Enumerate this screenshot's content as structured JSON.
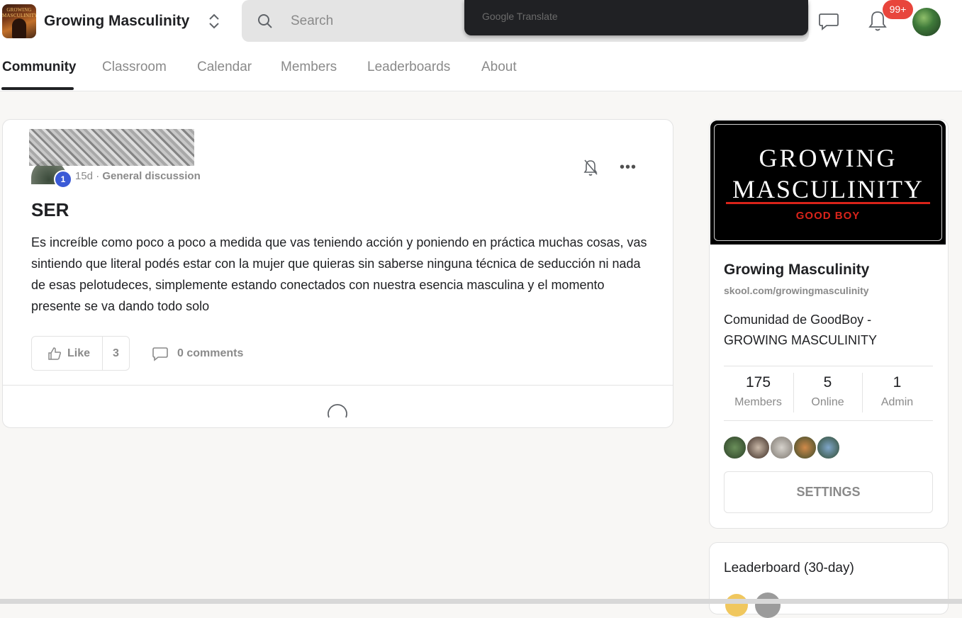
{
  "header": {
    "brand": "Growing Masculinity",
    "logo_text": "GROWING MASCULINITY",
    "search_placeholder": "Search",
    "translate_bar": "Google Translate",
    "notifications_badge": "99+"
  },
  "nav": {
    "tabs": [
      {
        "label": "Community",
        "active": true
      },
      {
        "label": "Classroom",
        "active": false
      },
      {
        "label": "Calendar",
        "active": false
      },
      {
        "label": "Members",
        "active": false
      },
      {
        "label": "Leaderboards",
        "active": false
      },
      {
        "label": "About",
        "active": false
      }
    ]
  },
  "post": {
    "author_level": "1",
    "age": "15d",
    "separator": "·",
    "category": "General discussion",
    "title": "SER",
    "body": "Es increíble como poco a poco a medida que vas teniendo acción y poniendo en práctica muchas cosas, vas sintiendo que literal podés estar con la mujer que quieras sin saberse ninguna técnica de seducción ni nada de esas pelotudeces, simplemente estando conectados con nuestra esencia masculina y el momento presente se va dando todo solo",
    "like_label": "Like",
    "like_count": "3",
    "comments_label": "0 comments"
  },
  "sidebar": {
    "cover": {
      "line1": "GROWING",
      "line2": "MASCULINITY",
      "line3": "GOOD BOY"
    },
    "name": "Growing Masculinity",
    "url": "skool.com/growingmasculinity",
    "description": "Comunidad de GoodBoy - GROWING MASCULINITY",
    "stats": [
      {
        "value": "175",
        "label": "Members"
      },
      {
        "value": "5",
        "label": "Online"
      },
      {
        "value": "1",
        "label": "Admin"
      }
    ],
    "settings_label": "SETTINGS"
  },
  "leaderboard": {
    "title": "Leaderboard (30-day)"
  },
  "colors": {
    "accent": "#202124",
    "badge": "#e8453c",
    "level": "#3b5ad6",
    "brand_red": "#d9231a"
  }
}
